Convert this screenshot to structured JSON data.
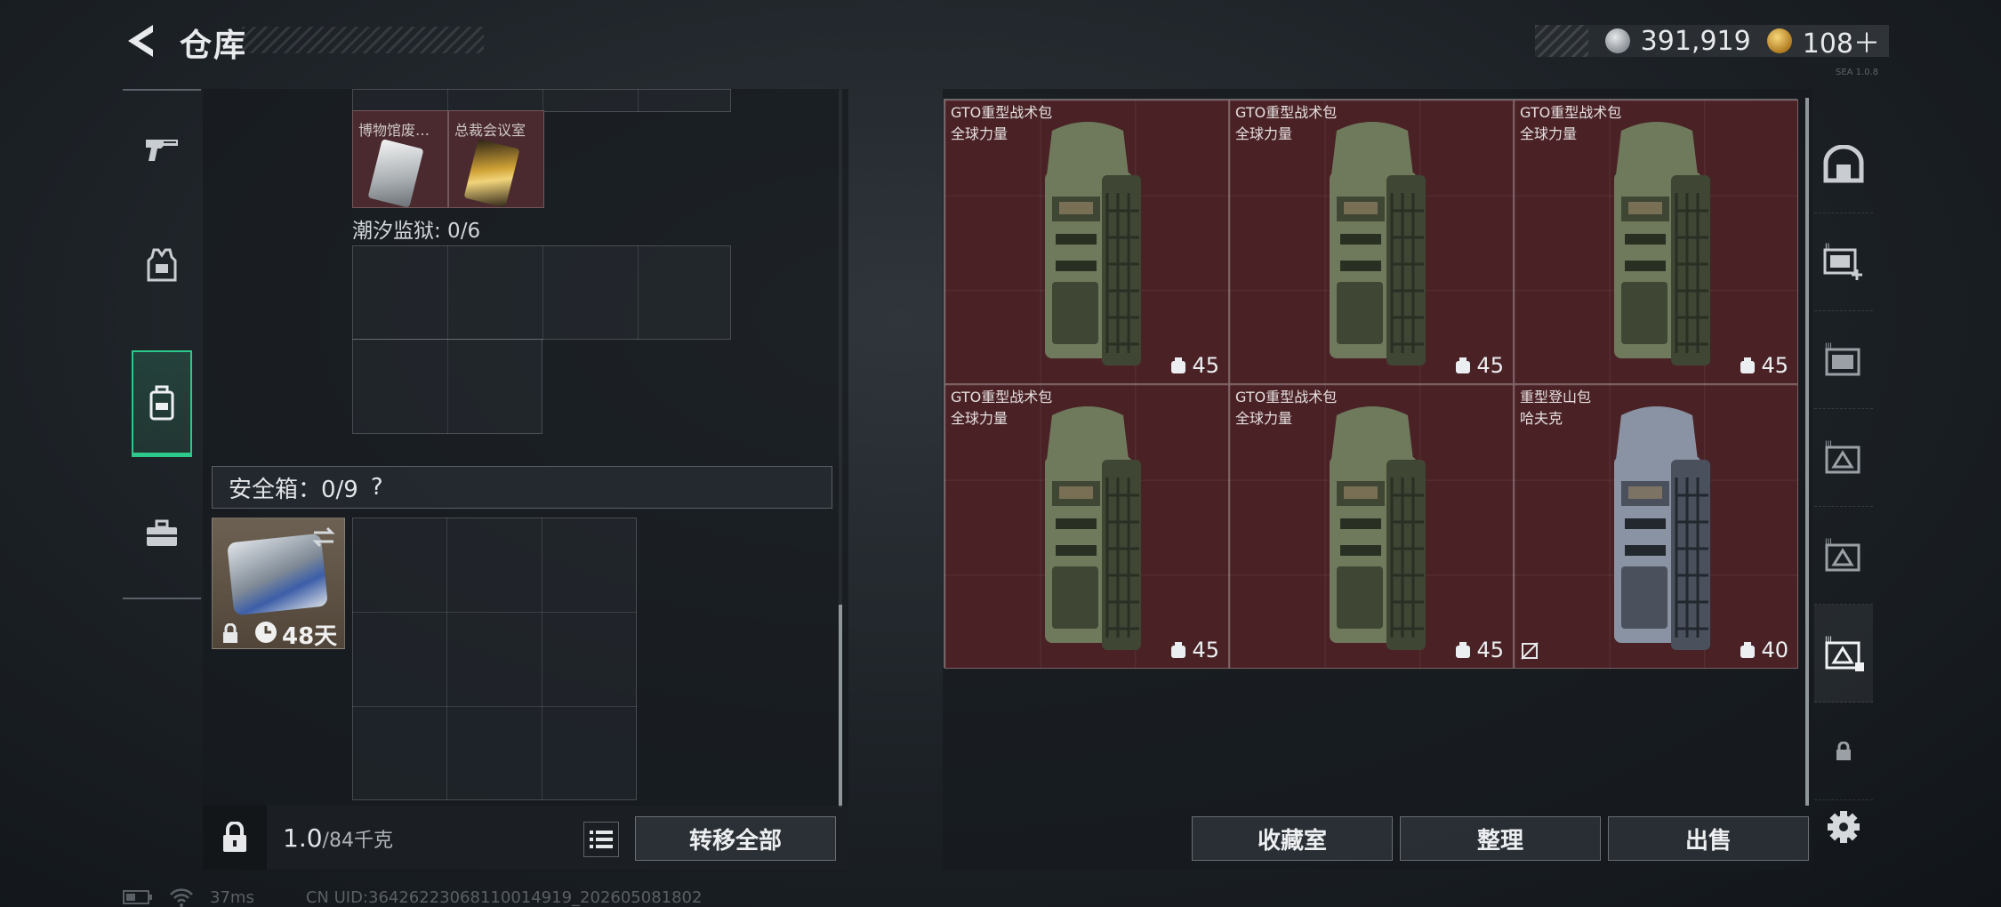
{
  "header": {
    "title": "仓库",
    "currency": [
      {
        "icon": "silver-coin-icon",
        "value": "391,919"
      },
      {
        "icon": "gold-coin-icon",
        "value": "108＋"
      }
    ],
    "version": "SEA 1.0.8"
  },
  "left_nav": [
    {
      "icon": "pistol-icon"
    },
    {
      "icon": "vest-icon"
    },
    {
      "icon": "backpack-icon",
      "active": true
    },
    {
      "icon": "briefcase-icon"
    }
  ],
  "container": {
    "keys": [
      {
        "name": "博物馆废…",
        "style": "silver"
      },
      {
        "name": "总裁会议室",
        "style": "gold"
      }
    ],
    "prison_label": "潮汐监狱: 0/6",
    "safebox_label": "安全箱：0/9",
    "safebox_help": "?",
    "safebox_days": "48天"
  },
  "weight": {
    "current": "1.0",
    "max": "/84千克"
  },
  "buttons": {
    "transfer_all": "转移全部",
    "collection": "收藏室",
    "organize": "整理",
    "sell": "出售"
  },
  "stash_items": [
    {
      "name": "GTO重型战术包",
      "brand": "全球力量",
      "capacity": "45",
      "color": "green",
      "no_sell": false
    },
    {
      "name": "GTO重型战术包",
      "brand": "全球力量",
      "capacity": "45",
      "color": "green",
      "no_sell": false
    },
    {
      "name": "GTO重型战术包",
      "brand": "全球力量",
      "capacity": "45",
      "color": "green",
      "no_sell": false
    },
    {
      "name": "GTO重型战术包",
      "brand": "全球力量",
      "capacity": "45",
      "color": "green",
      "no_sell": false
    },
    {
      "name": "GTO重型战术包",
      "brand": "全球力量",
      "capacity": "45",
      "color": "green",
      "no_sell": false
    },
    {
      "name": "重型登山包",
      "brand": "哈夫克",
      "capacity": "40",
      "color": "gray",
      "no_sell": true
    }
  ],
  "right_nav": [
    {
      "icon": "safe-icon"
    },
    {
      "icon": "stash-add-icon"
    },
    {
      "icon": "stash-tab-3-icon"
    },
    {
      "icon": "stash-tab-4-icon"
    },
    {
      "icon": "stash-tab-5-icon"
    },
    {
      "icon": "stash-tab-6-icon",
      "active": true
    },
    {
      "icon": "lock-icon"
    },
    {
      "icon": "settings-gear-icon"
    }
  ],
  "status": {
    "ping": "37ms",
    "uid": "CN UID:3642622306811001491​9_202605081802"
  }
}
